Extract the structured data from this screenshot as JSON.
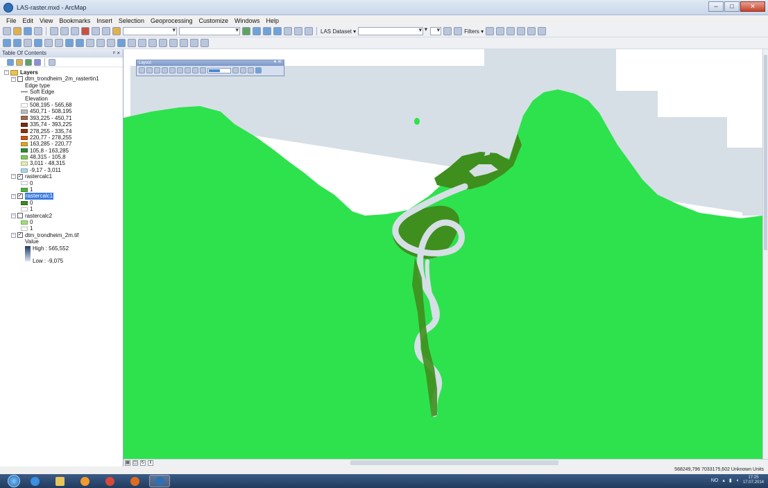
{
  "window": {
    "title": "LAS-raster.mxd - ArcMap",
    "controls": {
      "minimize": "–",
      "maximize": "□",
      "close": "✕"
    }
  },
  "menu": [
    "File",
    "Edit",
    "View",
    "Bookmarks",
    "Insert",
    "Selection",
    "Geoprocessing",
    "Customize",
    "Windows",
    "Help"
  ],
  "toolbar": {
    "las_dataset_label": "LAS Dataset ▾",
    "filters_label": "Filters ▾"
  },
  "toc": {
    "title": "Table Of Contents",
    "header_controls": "ᵖ ×",
    "root_label": "Layers",
    "layers": [
      {
        "name": "dtm_trondheim_2m_rastertin1",
        "checked": false,
        "sublabels": [
          "Edge type"
        ],
        "edge": "Soft Edge",
        "elev_label": "Elevation",
        "classes": [
          {
            "label": "508,195 - 565,68",
            "color": "#ffffff"
          },
          {
            "label": "450,71 - 508,195",
            "color": "#bdbdbd"
          },
          {
            "label": "393,225 - 450,71",
            "color": "#a06a52"
          },
          {
            "label": "335,74 - 393,225",
            "color": "#7a2a14"
          },
          {
            "label": "278,255 - 335,74",
            "color": "#8a3412"
          },
          {
            "label": "220,77 - 278,255",
            "color": "#c4561a"
          },
          {
            "label": "163,285 - 220,77",
            "color": "#d9a62a"
          },
          {
            "label": "105,8 - 163,285",
            "color": "#2f8a3a"
          },
          {
            "label": "48,315 - 105,8",
            "color": "#82c95a"
          },
          {
            "label": "3,011 - 48,315",
            "color": "#e4efb0"
          },
          {
            "label": "-9,17 - 3,011",
            "color": "#a9d9ea"
          }
        ]
      },
      {
        "name": "rastercalc1",
        "checked": true,
        "values": [
          {
            "label": "0",
            "color": "#ffffff"
          },
          {
            "label": "1",
            "color": "#4fb53a"
          }
        ]
      },
      {
        "name": "rastercalc1",
        "checked": true,
        "selected": true,
        "values": [
          {
            "label": "0",
            "color": "#3d8a22"
          },
          {
            "label": "1",
            "color": "#ffffff"
          }
        ]
      },
      {
        "name": "rastercalc2",
        "checked": false,
        "values": [
          {
            "label": "0",
            "color": "#9fe07a"
          },
          {
            "label": "1",
            "color": "#ffffff"
          }
        ]
      },
      {
        "name": "dtm_trondheim_2m.tif",
        "checked": true,
        "value_label": "Value",
        "high": "High : 565,552",
        "low": "Low : -9,075"
      }
    ]
  },
  "layout_toolbar": {
    "title": "Layout",
    "close": "▾ ✕"
  },
  "map": {
    "colors": {
      "land": "#2ee24e",
      "dark_land": "#3f8f1e",
      "water": "#d6dfe6",
      "background": "#ffffff"
    }
  },
  "statusbar": {
    "coordinates": "568249,796  7033175,602 Unknown Units"
  },
  "taskbar": {
    "tray_lang": "NO",
    "clock_time": "17:25",
    "clock_date": "17.07.2014"
  }
}
